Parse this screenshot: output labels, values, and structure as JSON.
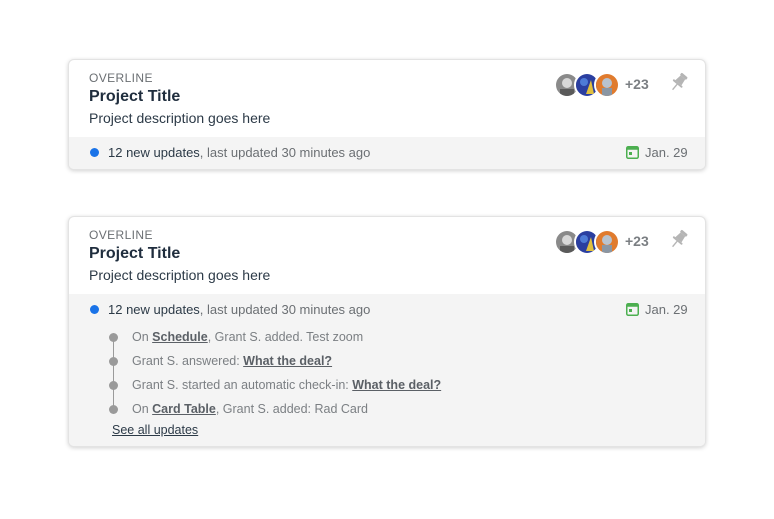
{
  "cards": [
    {
      "overline": "OVERLINE",
      "title": "Project Title",
      "description": "Project description goes here",
      "members_more": "+23",
      "updates_count": "12 new updates",
      "updates_suffix": ", last updated 30 minutes ago",
      "date": "Jan. 29",
      "expanded": false
    },
    {
      "overline": "OVERLINE",
      "title": "Project Title",
      "description": "Project description goes here",
      "members_more": "+23",
      "updates_count": "12 new updates",
      "updates_suffix": ", last updated 30 minutes ago",
      "date": "Jan. 29",
      "expanded": true,
      "updates": [
        {
          "prefix": "On ",
          "link": "Schedule",
          "suffix": ", Grant S. added. Test zoom"
        },
        {
          "prefix": "Grant S. answered: ",
          "link": "What the deal?",
          "suffix": ""
        },
        {
          "prefix": "Grant S. started an automatic check-in: ",
          "link": "What the deal?",
          "suffix": ""
        },
        {
          "prefix": "On ",
          "link": "Card Table",
          "suffix": ", Grant S. added: Rad Card"
        }
      ],
      "see_all_label": "See all updates"
    }
  ],
  "colors": {
    "status_dot": "#1a73e8",
    "calendar_icon": "#4caf50",
    "timeline": "#9a9a9a"
  },
  "icons": [
    "avatar",
    "pin-icon",
    "calendar-icon"
  ]
}
